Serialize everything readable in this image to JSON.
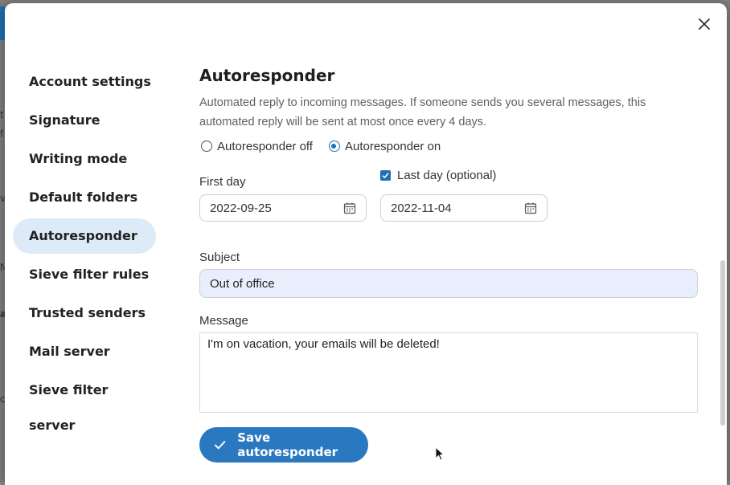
{
  "dialog": {
    "close_icon": "close-icon"
  },
  "sidebar": {
    "items": [
      {
        "label": "Account settings",
        "active": false
      },
      {
        "label": "Signature",
        "active": false
      },
      {
        "label": "Writing mode",
        "active": false
      },
      {
        "label": "Default folders",
        "active": false
      },
      {
        "label": "Autoresponder",
        "active": true
      },
      {
        "label": "Sieve filter rules",
        "active": false
      },
      {
        "label": "Trusted senders",
        "active": false
      },
      {
        "label": "Mail server",
        "active": false
      },
      {
        "label": "Sieve filter server",
        "active": false
      }
    ]
  },
  "autoresponder": {
    "title": "Autoresponder",
    "description": "Automated reply to incoming messages. If someone sends you several messages, this automated reply will be sent at most once every 4 days.",
    "radio_off_label": "Autoresponder off",
    "radio_on_label": "Autoresponder on",
    "selected": "on",
    "first_day_label": "First day",
    "first_day_value": "2022-09-25",
    "last_day_label": "Last day (optional)",
    "last_day_checked": true,
    "last_day_value": "2022-11-04",
    "subject_label": "Subject",
    "subject_value": "Out of office",
    "message_label": "Message",
    "message_value": "I'm on vacation, your emails will be deleted!",
    "save_label": "Save autoresponder"
  },
  "colors": {
    "accent": "#2a78bf",
    "active_nav_bg": "#dcebf7",
    "subject_bg": "#e8eefb"
  }
}
